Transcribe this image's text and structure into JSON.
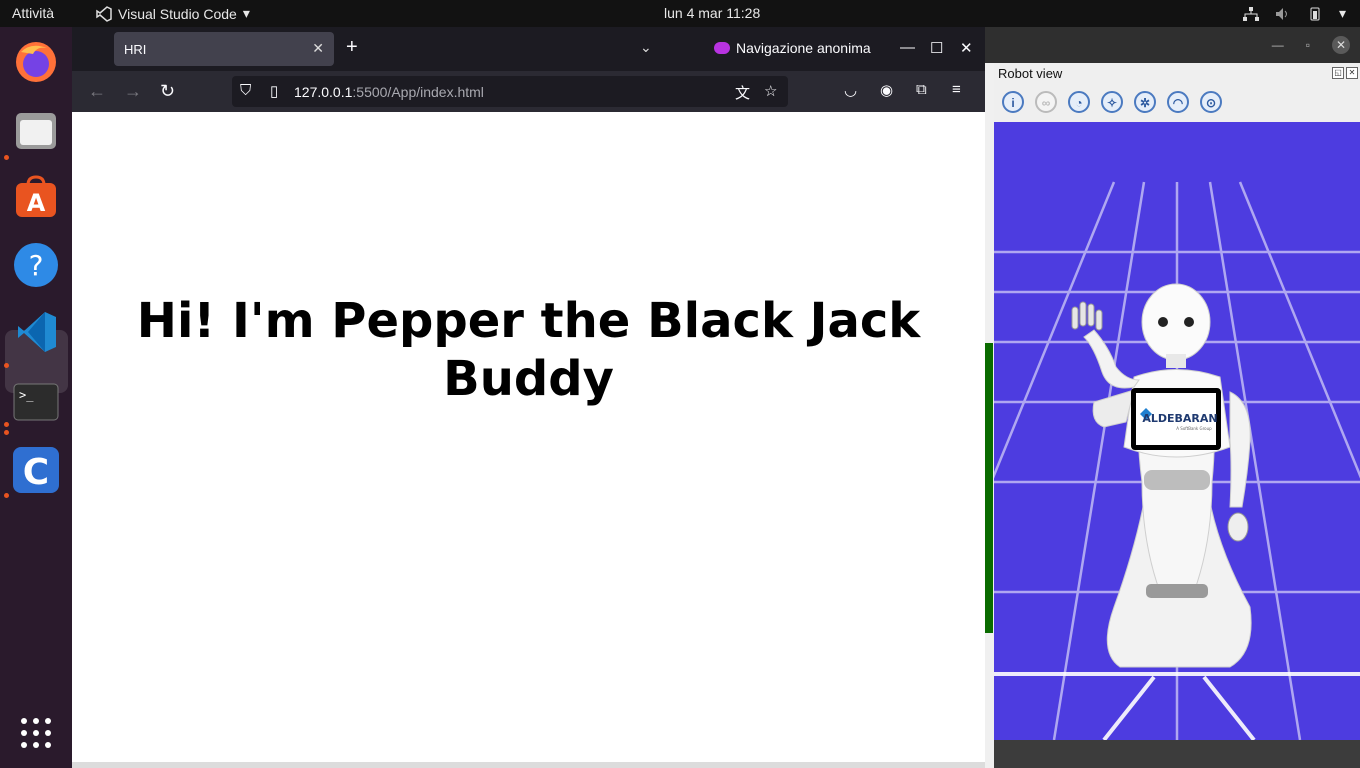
{
  "topbar": {
    "activities": "Attività",
    "app_name": "Visual Studio Code",
    "clock": "lun 4 mar  11:28"
  },
  "dock": {
    "items": [
      "firefox-icon",
      "files-icon",
      "app-center-icon",
      "help-icon",
      "vscode-icon",
      "terminal-icon",
      "choregraphe-icon",
      "app-grid-icon"
    ]
  },
  "browser": {
    "tab_title": "HRI",
    "private_label": "Navigazione anonima",
    "url_host": "127.0.0.1",
    "url_rest": ":5500/App/index.html",
    "page_heading": "Hi! I'm Pepper the Black Jack Buddy"
  },
  "robot_view": {
    "title": "Robot view",
    "tablet_brand": "ALDEBARAN",
    "tablet_sub": "A SoftBank Group",
    "colors": {
      "background": "#4d3ce0",
      "grid": "#ffffff"
    }
  }
}
